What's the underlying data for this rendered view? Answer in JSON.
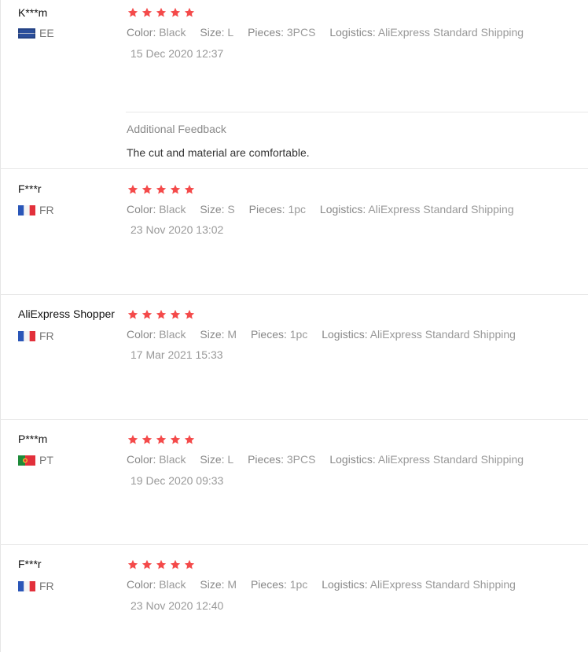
{
  "reviews": [
    {
      "user": "K***m",
      "country": "EE",
      "stars": 5,
      "color_label": "Color:",
      "color": "Black",
      "size_label": "Size:",
      "size": "L",
      "pieces_label": "Pieces:",
      "pieces": "3PCS",
      "logistics_label": "Logistics:",
      "logistics": "AliExpress Standard Shipping",
      "date": "15 Dec 2020 12:37",
      "additional_title": "Additional Feedback",
      "additional_text": "The cut and material are comfortable."
    },
    {
      "user": "F***r",
      "country": "FR",
      "stars": 5,
      "color_label": "Color:",
      "color": "Black",
      "size_label": "Size:",
      "size": "S",
      "pieces_label": "Pieces:",
      "pieces": "1pc",
      "logistics_label": "Logistics:",
      "logistics": "AliExpress Standard Shipping",
      "date": "23 Nov 2020 13:02"
    },
    {
      "user": "AliExpress Shopper",
      "country": "FR",
      "stars": 5,
      "color_label": "Color:",
      "color": "Black",
      "size_label": "Size:",
      "size": "M",
      "pieces_label": "Pieces:",
      "pieces": "1pc",
      "logistics_label": "Logistics:",
      "logistics": "AliExpress Standard Shipping",
      "date": "17 Mar 2021 15:33"
    },
    {
      "user": "P***m",
      "country": "PT",
      "stars": 5,
      "color_label": "Color:",
      "color": "Black",
      "size_label": "Size:",
      "size": "L",
      "pieces_label": "Pieces:",
      "pieces": "3PCS",
      "logistics_label": "Logistics:",
      "logistics": "AliExpress Standard Shipping",
      "date": "19 Dec 2020 09:33"
    },
    {
      "user": "F***r",
      "country": "FR",
      "stars": 5,
      "color_label": "Color:",
      "color": "Black",
      "size_label": "Size:",
      "size": "M",
      "pieces_label": "Pieces:",
      "pieces": "1pc",
      "logistics_label": "Logistics:",
      "logistics": "AliExpress Standard Shipping",
      "date": "23 Nov 2020 12:40"
    }
  ],
  "colors": {
    "star": "#f44a4a",
    "divider": "#e8e8e8",
    "muted_text": "#999999"
  },
  "icons": {
    "star": "star-icon",
    "flag_ee": "flag-ee-icon",
    "flag_fr": "flag-fr-icon",
    "flag_pt": "flag-pt-icon"
  }
}
